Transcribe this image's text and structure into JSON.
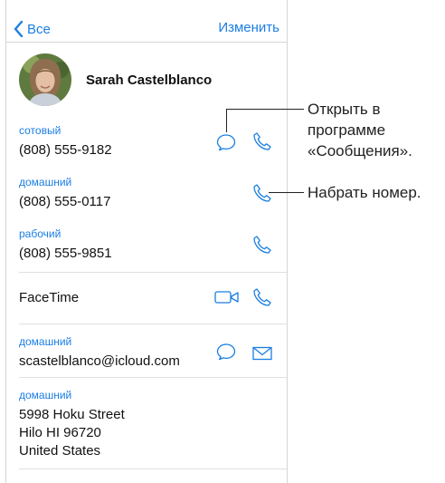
{
  "nav": {
    "back_label": "Все",
    "edit_label": "Изменить"
  },
  "contact": {
    "name": "Sarah Castelblanco"
  },
  "fields": [
    {
      "label": "сотовый",
      "value": "(808) 555-9182"
    },
    {
      "label": "домашний",
      "value": "(808) 555-0117"
    },
    {
      "label": "рабочий",
      "value": "(808) 555-9851"
    },
    {
      "value": "FaceTime"
    },
    {
      "label": "домашний",
      "value": "scastelblanco@icloud.com"
    },
    {
      "label": "домашний",
      "lines": [
        "5998 Hoku Street",
        "Hilo HI 96720",
        "United States"
      ]
    }
  ],
  "callouts": {
    "messages_lines": [
      "Открыть в",
      "программе",
      "«Сообщения»."
    ],
    "dial": "Набрать номер."
  },
  "colors": {
    "accent": "#1a7ee3",
    "text": "#111111",
    "separator": "#e0e0e0"
  },
  "icons": [
    "chevron-left-icon",
    "message-bubble-icon",
    "phone-icon",
    "video-camera-icon",
    "envelope-icon"
  ]
}
